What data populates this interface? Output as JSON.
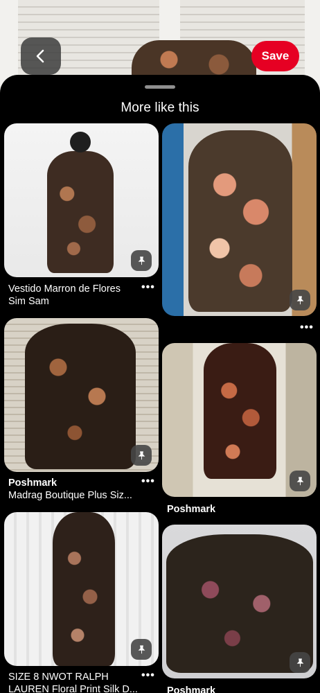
{
  "header": {
    "save_label": "Save",
    "back_icon": "chevron-left-icon"
  },
  "sheet": {
    "title": "More like this"
  },
  "pins": [
    {
      "title_line1": "Vestido Marron de Flores",
      "title_line2": "Sim Sam",
      "more": "•••"
    },
    {
      "more": "•••"
    },
    {
      "source": "Poshmark",
      "subtitle": "Madrag Boutique Plus Siz...",
      "more": "•••"
    },
    {
      "source": "Poshmark"
    },
    {
      "title_line1": "SIZE 8 NWOT RALPH",
      "title_line2": "LAUREN Floral Print Silk D...",
      "more": "•••"
    },
    {
      "source": "Poshmark"
    }
  ],
  "colors": {
    "accent": "#e60023",
    "background": "#000000"
  }
}
